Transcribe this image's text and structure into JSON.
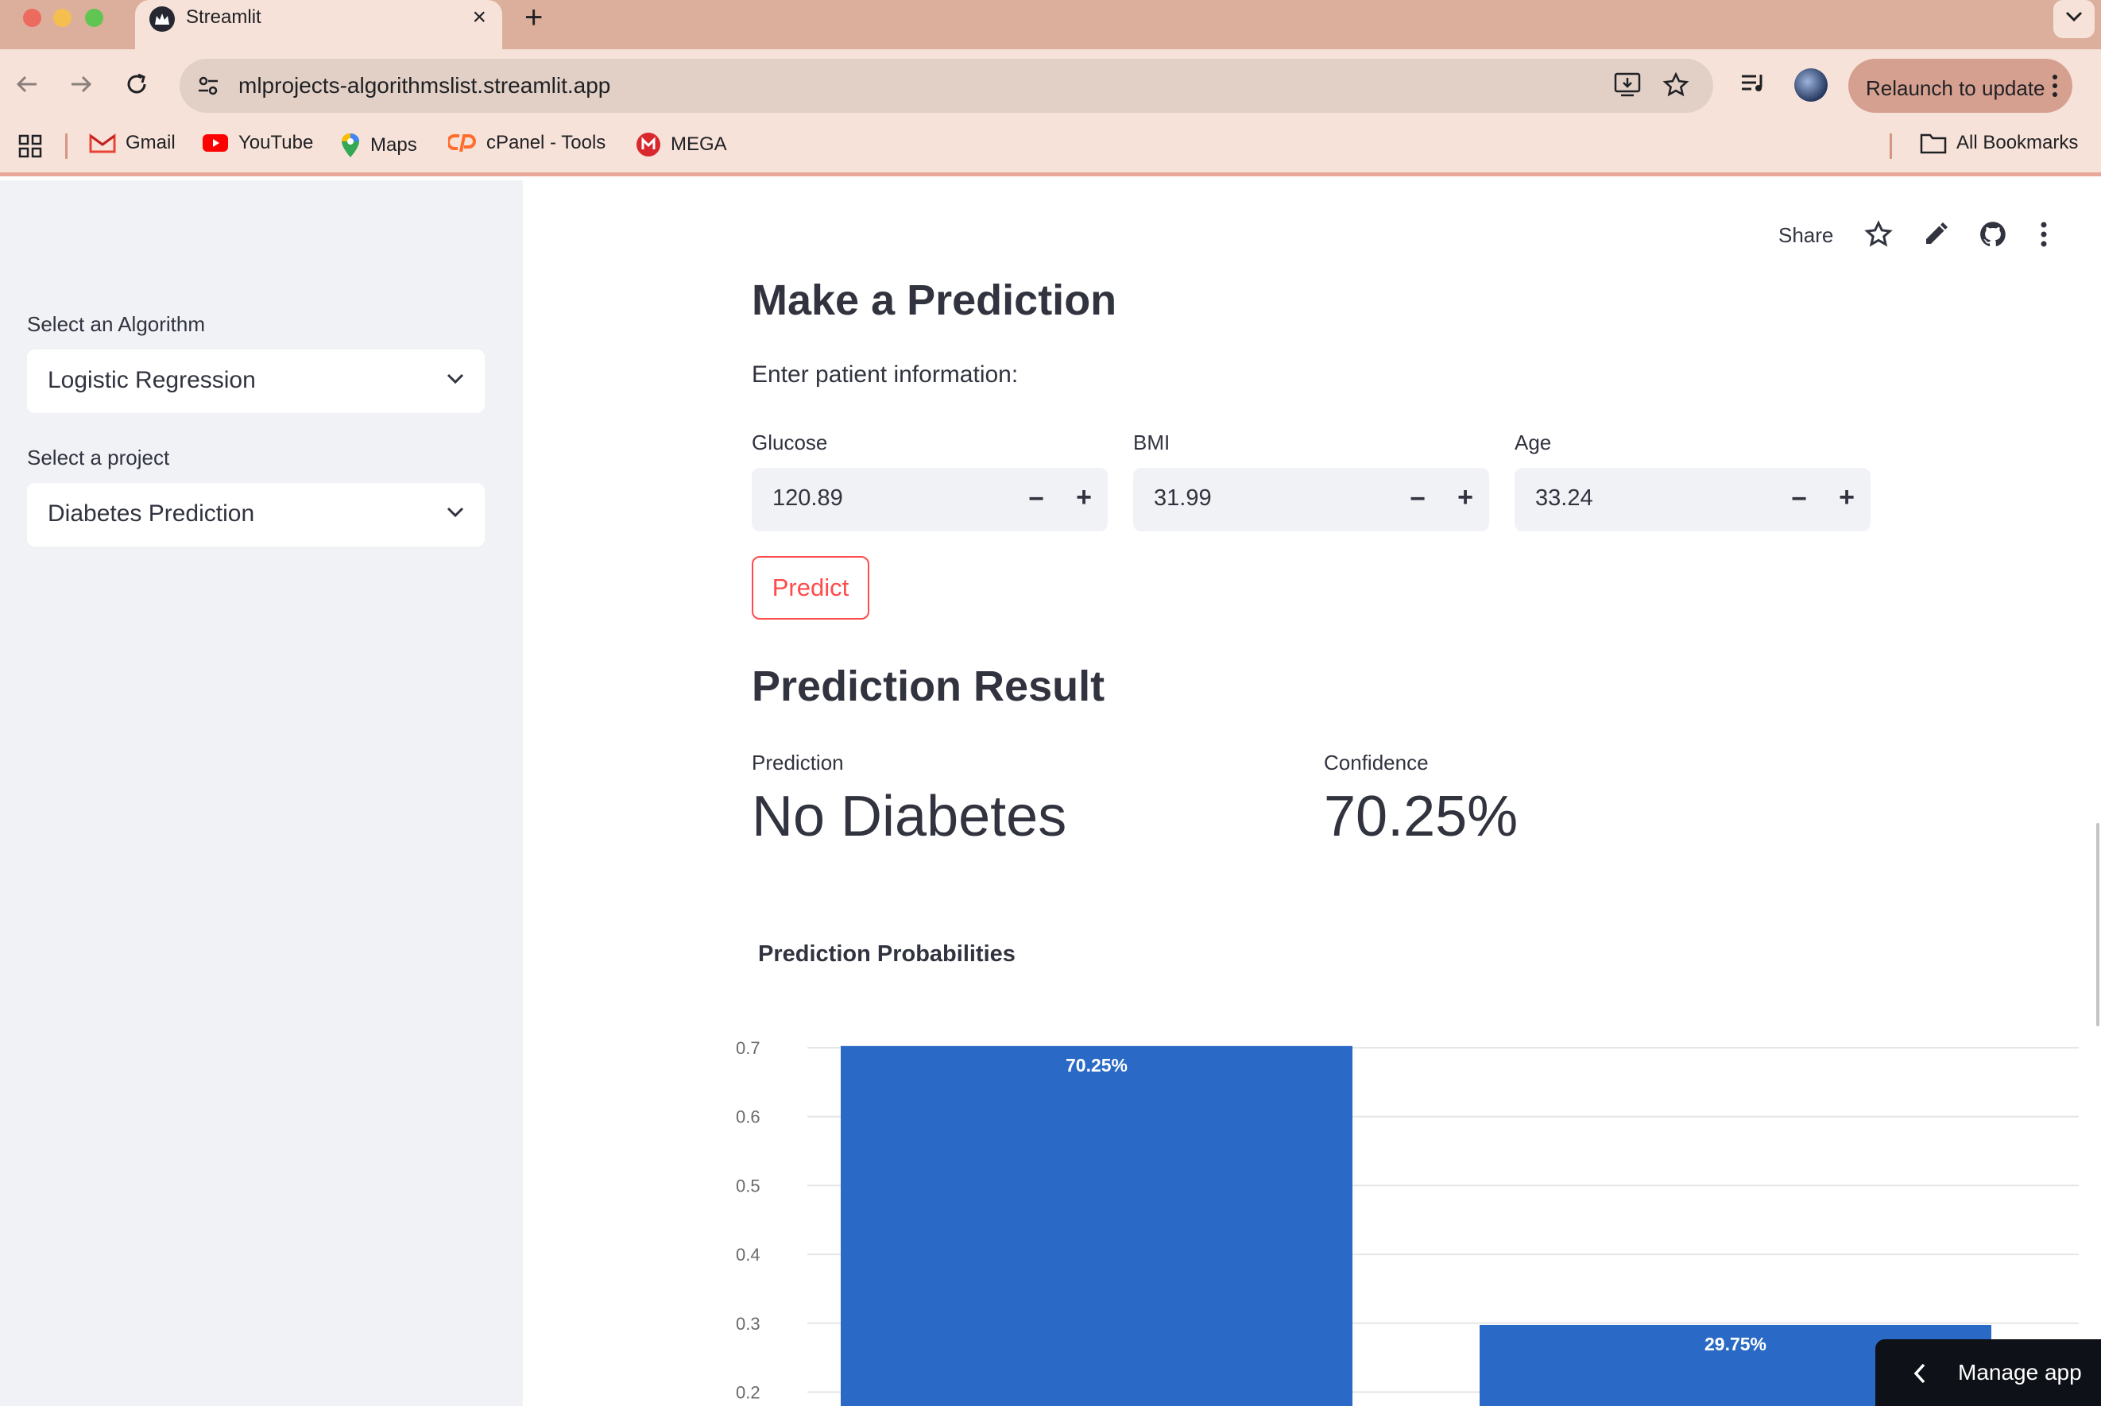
{
  "browser": {
    "tab_title": "Streamlit",
    "url": "mlprojects-algorithmslist.streamlit.app",
    "relaunch_label": "Relaunch to update",
    "bookmarks": [
      {
        "label": "Gmail",
        "icon": "gmail-icon"
      },
      {
        "label": "YouTube",
        "icon": "youtube-icon"
      },
      {
        "label": "Maps",
        "icon": "maps-icon"
      },
      {
        "label": "cPanel - Tools",
        "icon": "cpanel-icon"
      },
      {
        "label": "MEGA",
        "icon": "mega-icon"
      }
    ],
    "all_bookmarks_label": "All Bookmarks"
  },
  "sidebar": {
    "algorithm_label": "Select an Algorithm",
    "algorithm_value": "Logistic Regression",
    "project_label": "Select a project",
    "project_value": "Diabetes Prediction"
  },
  "app_toolbar": {
    "share_label": "Share"
  },
  "main": {
    "heading": "Make a Prediction",
    "subtitle": "Enter patient information:",
    "inputs": [
      {
        "label": "Glucose",
        "value": "120.89"
      },
      {
        "label": "BMI",
        "value": "31.99"
      },
      {
        "label": "Age",
        "value": "33.24"
      }
    ],
    "predict_label": "Predict",
    "result_heading": "Prediction Result",
    "metrics": [
      {
        "label": "Prediction",
        "value": "No Diabetes"
      },
      {
        "label": "Confidence",
        "value": "70.25%"
      }
    ],
    "chart_heading": "Prediction Probabilities"
  },
  "chart_data": {
    "type": "bar",
    "title": "Prediction Probabilities",
    "values": [
      0.7025,
      0.2975
    ],
    "data_labels": [
      "70.25%",
      "29.75%"
    ],
    "y_ticks": [
      "0.7",
      "0.6",
      "0.5",
      "0.4",
      "0.3",
      "0.2"
    ],
    "ylim_visible": [
      0.2,
      0.7
    ],
    "bar_color": "#2a6ac6",
    "grid": true
  },
  "manage_app_label": "Manage app",
  "colors": {
    "accent": "#ff4b4b",
    "sidebar_bg": "#f0f2f6",
    "chrome_tabbar": "#dcae9c",
    "chrome_toolbar": "#f6e2d9"
  }
}
